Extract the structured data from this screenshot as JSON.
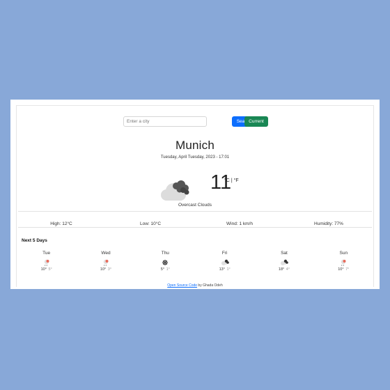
{
  "search": {
    "placeholder": "Enter a city",
    "search_label": "Search",
    "current_label": "Current"
  },
  "current": {
    "city": "Munich",
    "datetime": "Tuesday, April Tuesday, 2023 - 17:01",
    "temperature": "11",
    "unit_celsius": "°C",
    "unit_separator": "|",
    "unit_fahrenheit": "°F",
    "description": "Overcast Clouds",
    "icon": "overcast-clouds-icon"
  },
  "stats": {
    "high": "High: 12°C",
    "low": "Low: 10°C",
    "wind": "Wind: 1 km/h",
    "humidity": "Humidity: 77%"
  },
  "forecast": {
    "title": "Next 5 Days",
    "days": [
      {
        "day": "Tue",
        "high": "10°",
        "low": "5°",
        "icon": "rain-icon"
      },
      {
        "day": "Wed",
        "high": "10°",
        "low": "3°",
        "icon": "rain-icon"
      },
      {
        "day": "Thu",
        "high": "5°",
        "low": "1°",
        "icon": "snow-icon"
      },
      {
        "day": "Fri",
        "high": "13°",
        "low": "1°",
        "icon": "partly-cloudy-icon"
      },
      {
        "day": "Sat",
        "high": "18°",
        "low": "4°",
        "icon": "partly-cloudy-icon"
      },
      {
        "day": "Sun",
        "high": "10°",
        "low": "7°",
        "icon": "rain-icon"
      }
    ]
  },
  "footer": {
    "link_text": "Open Source Code",
    "suffix": " by Ghada Odeh"
  },
  "colors": {
    "background": "#88a8d8",
    "search_button": "#0d6efd",
    "current_button": "#198754"
  }
}
